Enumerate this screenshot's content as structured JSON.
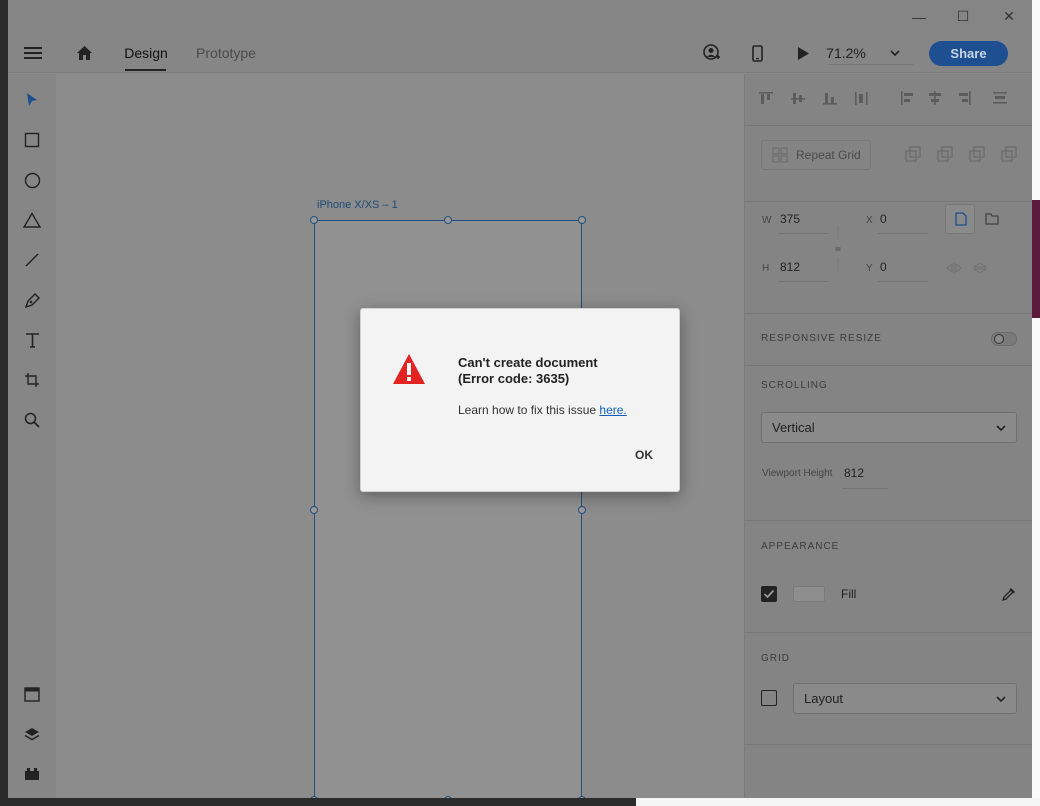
{
  "window": {
    "controls": {
      "minimize": "—",
      "maximize": "☐",
      "close": "✕"
    }
  },
  "appbar": {
    "menu_icon": "hamburger-icon",
    "home_icon": "home-icon",
    "tabs": [
      {
        "label": "Design",
        "active": true
      },
      {
        "label": "Prototype",
        "active": false
      }
    ],
    "zoom": "71.2%",
    "share_label": "Share"
  },
  "toolbar": {
    "tools": [
      "select-icon",
      "rectangle-icon",
      "ellipse-icon",
      "polygon-icon",
      "line-icon",
      "pen-icon",
      "text-icon",
      "artboard-icon",
      "zoom-icon"
    ],
    "bottom_tools": [
      "document-assets-icon",
      "layers-icon",
      "plugins-icon"
    ]
  },
  "canvas": {
    "artboard_name": "iPhone X/XS – 1"
  },
  "panel": {
    "repeat_grid_label": "Repeat Grid",
    "transform": {
      "w_key": "W",
      "w_val": "375",
      "h_key": "H",
      "h_val": "812",
      "x_key": "X",
      "x_val": "0",
      "y_key": "Y",
      "y_val": "0"
    },
    "responsive_resize_label": "RESPONSIVE RESIZE",
    "scrolling_label": "SCROLLING",
    "scrolling_value": "Vertical",
    "viewport_label": "Viewport Height",
    "viewport_value": "812",
    "appearance_label": "APPEARANCE",
    "fill_label": "Fill",
    "fill_checked": true,
    "grid_label": "GRID",
    "grid_checked": false,
    "grid_value": "Layout"
  },
  "dialog": {
    "title_line1": "Can't create document",
    "title_line2": "(Error code: 3635)",
    "body": "Learn how to fix this issue ",
    "link": "here.",
    "ok_label": "OK",
    "icon": "warning-icon",
    "accent": "#e32222"
  }
}
